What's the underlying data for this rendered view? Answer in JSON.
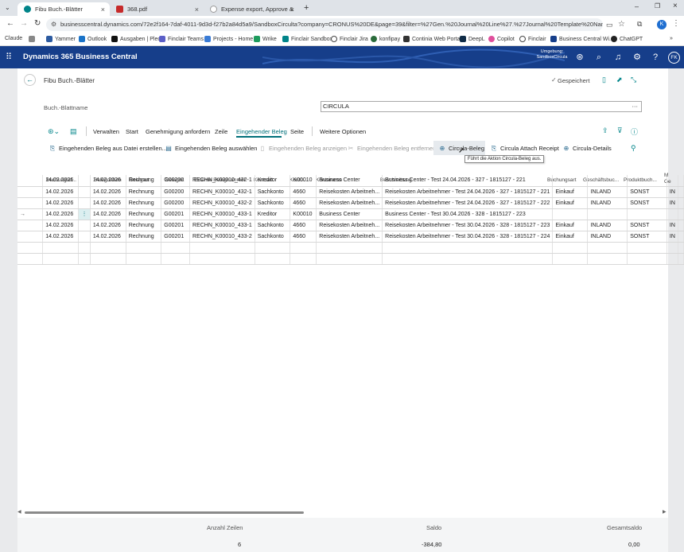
{
  "browser": {
    "tabs": [
      {
        "label": "Fibu Buch.-Blätter",
        "active": true
      },
      {
        "label": "368.pdf",
        "active": false
      },
      {
        "label": "Expense export, Approve & Co",
        "active": false
      }
    ],
    "url": "businesscentral.dynamics.com/72e2f164-7daf-4011-9d3d-f27b2a84d5a9/SandboxCirculta?company=CRONUS%20DE&page=39&filter=%27Gen.%20Journal%20Line%27.%27Journal%20Template%20Name%27%20IS%...",
    "profile_letter": "K",
    "bookmarks": [
      "Claude",
      "Yammer",
      "Outlook",
      "Ausgaben | Pleo",
      "Finclair Teams",
      "Projects - Home",
      "Wrike",
      "Finclair Sandbox",
      "Finclair Jira",
      "konfipay",
      "Continia Web Portal",
      "DeepL",
      "Copilot",
      "Finclair",
      "Business Central Wi...",
      "ChatGPT"
    ]
  },
  "app": {
    "title": "Dynamics 365 Business Central",
    "environment_line1": "Umgebung:",
    "environment_line2": "SandboxCircula",
    "user_initials": "FK"
  },
  "page": {
    "title": "Fibu Buch.-Blätter",
    "saved_status": "Gespeichert",
    "batch_label": "Buch.-Blattname",
    "batch_value": "CIRCULA"
  },
  "action_tabs": [
    "Verwalten",
    "Start",
    "Genehmigung anfordern",
    "Zeile",
    "Eingehender Beleg",
    "Seite",
    "Weitere Optionen"
  ],
  "sub_actions": [
    {
      "label": "Eingehenden Beleg aus Datei erstellen...",
      "enabled": true,
      "icon": "paperclip-icon"
    },
    {
      "label": "Eingehenden Beleg auswählen",
      "enabled": true,
      "icon": "document-list-icon"
    },
    {
      "label": "Eingehenden Beleg anzeigen",
      "enabled": false,
      "icon": "document-icon"
    },
    {
      "label": "Eingehenden Beleg entfernen",
      "enabled": false,
      "icon": "remove-link-icon"
    },
    {
      "label": "Circula-Beleg",
      "enabled": true,
      "icon": "globe-icon"
    },
    {
      "label": "Circula Attach Receipt",
      "enabled": true,
      "icon": "paperclip-icon"
    },
    {
      "label": "Circula-Details",
      "enabled": true,
      "icon": "globe-icon"
    }
  ],
  "tooltip": "Führt die Aktion Circula-Beleg aus.",
  "table": {
    "columns": [
      "Buchungsd...",
      "Belegdatum",
      "Belegart",
      "Belegnr.",
      "Externe Belegnummer",
      "Kontoart",
      "Konto...",
      "Kontoname",
      "Beschreibung",
      "Buchungsart",
      "Geschäftsbuc...",
      "Produktbuch...",
      "M",
      "Ge"
    ],
    "rows": [
      [
        "14.02.2026",
        "14.02.2026",
        "Rechnung",
        "G00200",
        "RECHN_K00010_432-1",
        "Kreditor",
        "K00010",
        "Business Center",
        "Business Center - Test 24.04.2026 - 327 - 1815127 - 221",
        "",
        "",
        "",
        ""
      ],
      [
        "14.02.2026",
        "14.02.2026",
        "Rechnung",
        "G00200",
        "RECHN_K00010_432-1",
        "Sachkonto",
        "4660",
        "Reisekosten Arbeitneh...",
        "Reisekosten Arbeitnehmer - Test 24.04.2026 - 327 - 1815127 - 221",
        "Einkauf",
        "INLAND",
        "SONST",
        "IN"
      ],
      [
        "14.02.2026",
        "14.02.2026",
        "Rechnung",
        "G00200",
        "RECHN_K00010_432-2",
        "Sachkonto",
        "4660",
        "Reisekosten Arbeitneh...",
        "Reisekosten Arbeitnehmer - Test 24.04.2026 - 327 - 1815127 - 222",
        "Einkauf",
        "INLAND",
        "SONST",
        "IN"
      ],
      [
        "14.02.2026",
        "14.02.2026",
        "Rechnung",
        "G00201",
        "RECHN_K00010_433-1",
        "Kreditor",
        "K00010",
        "Business Center",
        "Business Center - Test 30.04.2026 - 328 - 1815127 - 223",
        "",
        "",
        "",
        ""
      ],
      [
        "14.02.2026",
        "14.02.2026",
        "Rechnung",
        "G00201",
        "RECHN_K00010_433-1",
        "Sachkonto",
        "4660",
        "Reisekosten Arbeitneh...",
        "Reisekosten Arbeitnehmer - Test 30.04.2026 - 328 - 1815127 - 223",
        "Einkauf",
        "INLAND",
        "SONST",
        "IN"
      ],
      [
        "14.02.2026",
        "14.02.2026",
        "Rechnung",
        "G00201",
        "RECHN_K00010_433-2",
        "Sachkonto",
        "4660",
        "Reisekosten Arbeitneh...",
        "Reisekosten Arbeitnehmer - Test 30.04.2026 - 328 - 1815127 - 224",
        "Einkauf",
        "INLAND",
        "SONST",
        "IN"
      ]
    ],
    "selected_row": 3
  },
  "footer": {
    "count_label": "Anzahl Zeilen",
    "count_value": "6",
    "saldo_label": "Saldo",
    "saldo_value": "-384,80",
    "total_label": "Gesamtsaldo",
    "total_value": "0,00"
  },
  "colors": {
    "header_bg": "#163e8a",
    "accent": "#008489",
    "selected_tab": "#00707a"
  }
}
